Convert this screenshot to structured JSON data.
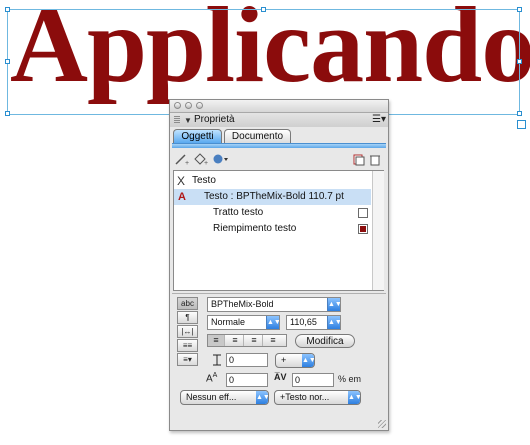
{
  "canvas": {
    "text": "Applicando",
    "text_color": "#8b0c0c",
    "selection_color": "#6fb8e0"
  },
  "panel": {
    "title": "Proprietà",
    "tabs": [
      {
        "label": "Oggetti",
        "active": true
      },
      {
        "label": "Documento",
        "active": false
      }
    ],
    "toolbar": {
      "stroke_tool": "pencil-icon",
      "fill_tool": "paint-bucket-icon",
      "effect_tool": "effects-icon",
      "duplicate": "duplicate-icon",
      "delete": "trash-icon"
    },
    "items": [
      {
        "icon": "X",
        "label": "Testo"
      },
      {
        "icon": "A",
        "label": "Testo : BPTheMix-Bold 110.7 pt"
      },
      {
        "label": "Tratto testo"
      },
      {
        "label": "Riempimento testo",
        "swatch": "#8b0c0c"
      }
    ],
    "side_buttons": [
      "abc",
      "¶",
      "|↔|",
      "≡≡",
      "≡▾"
    ],
    "font_name": "BPTheMix-Bold",
    "font_style": "Normale",
    "font_size": "110,65",
    "align": [
      "≡",
      "≡",
      "≡",
      "≡"
    ],
    "modifica_label": "Modifica",
    "leading_value": "0",
    "leading_mode": "+",
    "baseline_value": "0",
    "tracking_value": "0",
    "tracking_unit": "% em",
    "effect_select": "Nessun eff...",
    "style_select": "+Testo nor..."
  }
}
